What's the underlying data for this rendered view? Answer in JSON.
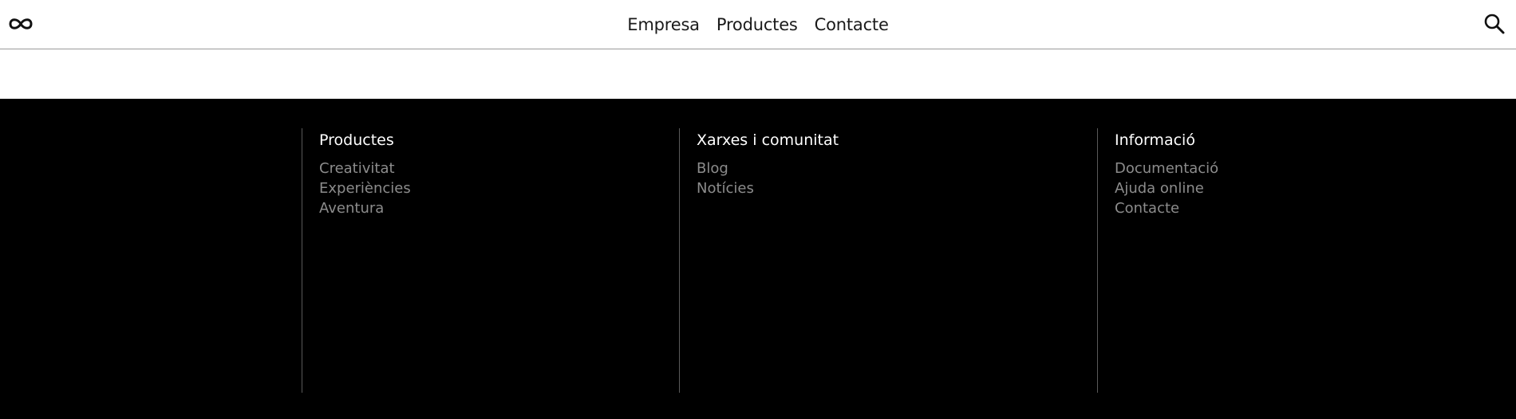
{
  "header": {
    "logo_icon": "infinity-icon",
    "nav": [
      {
        "label": "Empresa"
      },
      {
        "label": "Productes"
      },
      {
        "label": "Contacte"
      }
    ],
    "search_icon": "search-icon"
  },
  "footer": {
    "columns": [
      {
        "title": "Productes",
        "links": [
          "Creativitat",
          "Experiències",
          "Aventura"
        ]
      },
      {
        "title": "Xarxes i comunitat",
        "links": [
          "Blog",
          "Notícies"
        ]
      },
      {
        "title": "Informació",
        "links": [
          "Documentació",
          "Ajuda online",
          "Contacte"
        ]
      }
    ]
  },
  "colors": {
    "header_bg": "#ffffff",
    "footer_bg": "#000000",
    "footer_title": "#ffffff",
    "footer_link": "#8c8c8c",
    "divider": "#5a5a5a"
  }
}
